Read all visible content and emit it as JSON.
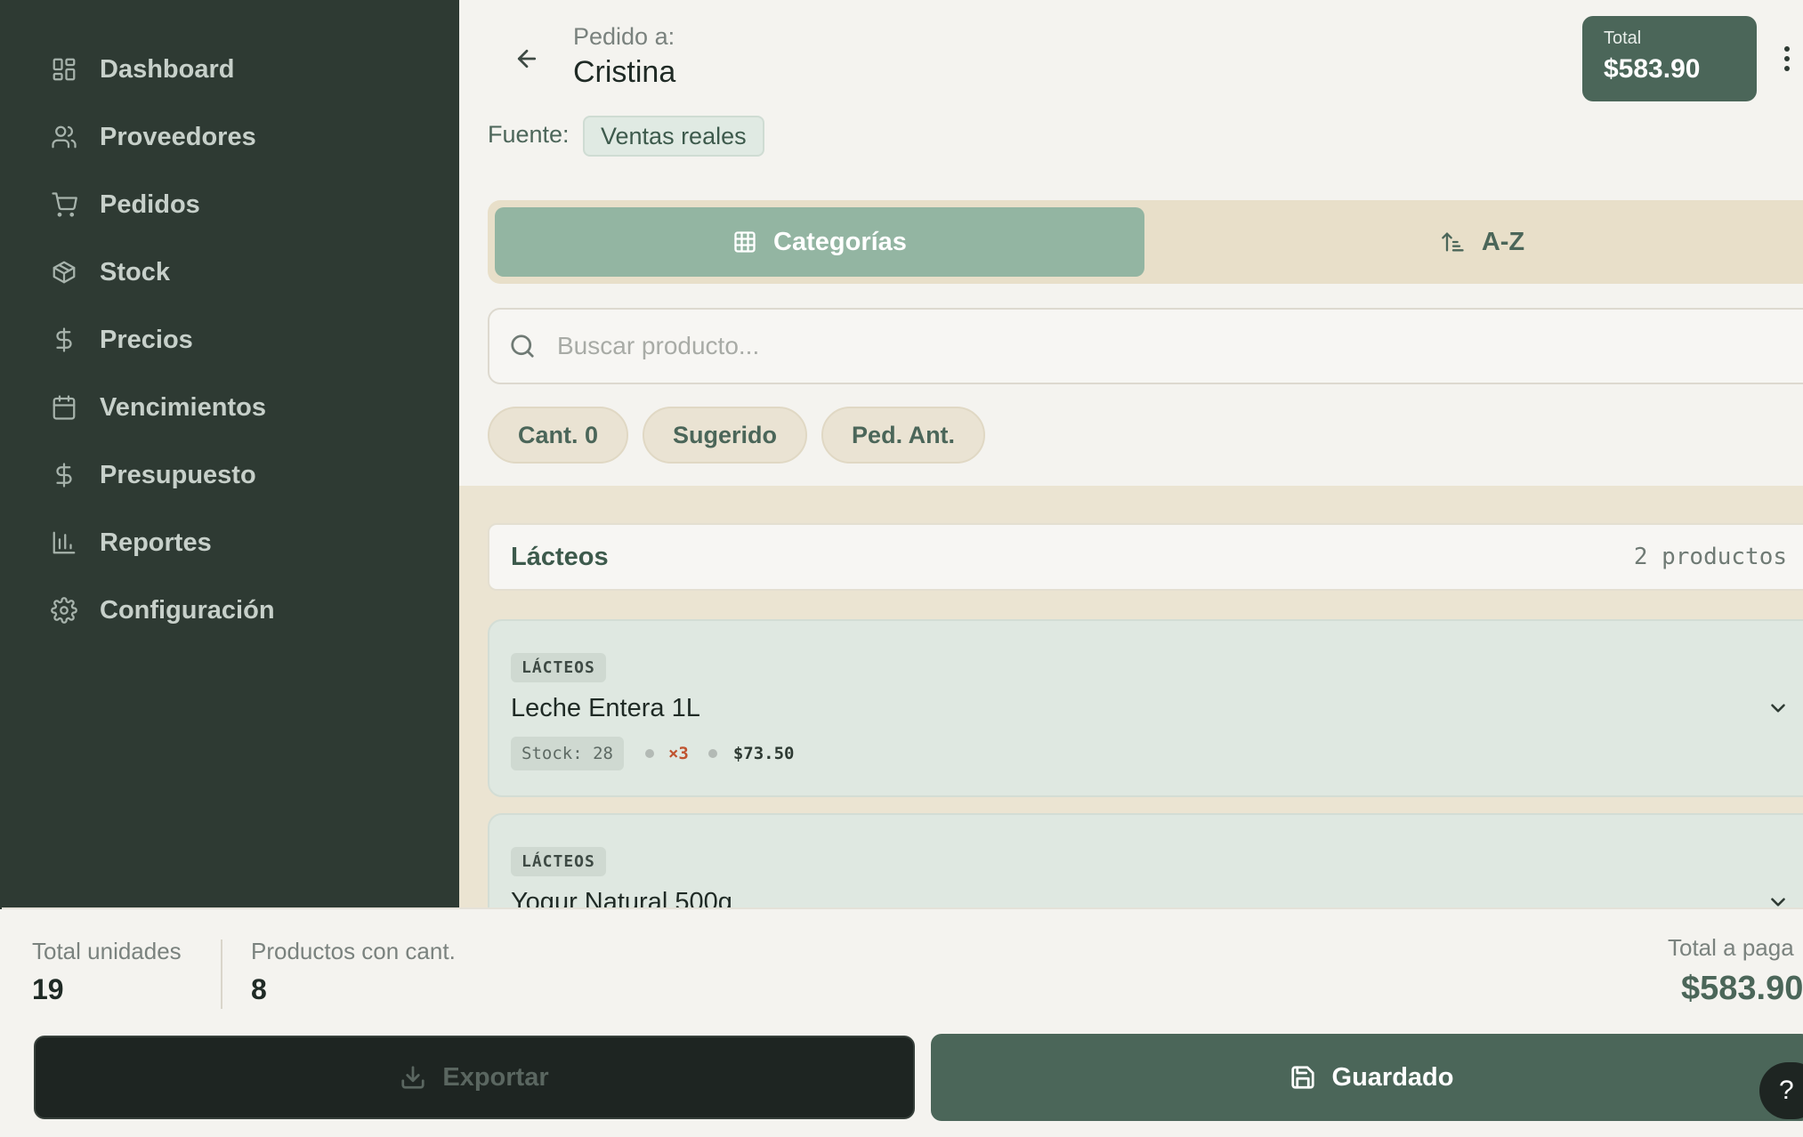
{
  "sidebar": {
    "items": [
      {
        "label": "Dashboard",
        "icon": "dashboard-icon"
      },
      {
        "label": "Proveedores",
        "icon": "users-icon"
      },
      {
        "label": "Pedidos",
        "icon": "cart-icon"
      },
      {
        "label": "Stock",
        "icon": "box-icon"
      },
      {
        "label": "Precios",
        "icon": "dollar-icon"
      },
      {
        "label": "Vencimientos",
        "icon": "calendar-icon"
      },
      {
        "label": "Presupuesto",
        "icon": "dollar-icon"
      },
      {
        "label": "Reportes",
        "icon": "bar-chart-icon"
      },
      {
        "label": "Configuración",
        "icon": "gear-icon"
      }
    ]
  },
  "header": {
    "pedido_label": "Pedido a:",
    "supplier": "Cristina",
    "total_label": "Total",
    "total_value": "$583.90"
  },
  "fuente": {
    "label": "Fuente:",
    "value": "Ventas reales"
  },
  "view_toggle": {
    "categorias": "Categorías",
    "az": "A-Z",
    "active": "categorias"
  },
  "search": {
    "placeholder": "Buscar producto...",
    "value": ""
  },
  "filters": [
    "Cant. 0",
    "Sugerido",
    "Ped. Ant."
  ],
  "category": {
    "title": "Lácteos",
    "count": "2 productos"
  },
  "products": [
    {
      "tag": "LÁCTEOS",
      "name": "Leche Entera 1L",
      "stock": "Stock: 28",
      "mult": "×3",
      "price": "$73.50"
    },
    {
      "tag": "LÁCTEOS",
      "name": "Yogur Natural 500g"
    }
  ],
  "footer": {
    "units_label": "Total unidades",
    "units_value": "19",
    "products_label": "Productos con cant.",
    "products_value": "8",
    "pay_label": "Total a paga",
    "pay_value": "$583.90",
    "export_label": "Exportar",
    "save_label": "Guardado",
    "help_label": "?"
  },
  "colors": {
    "sidebar_bg": "#2e3a33",
    "accent": "#4b6659",
    "accent_light": "#93b5a2",
    "toggle_bg": "#e8dfc9",
    "card_bg": "#dfe8e1",
    "multiplier": "#c0532f"
  }
}
